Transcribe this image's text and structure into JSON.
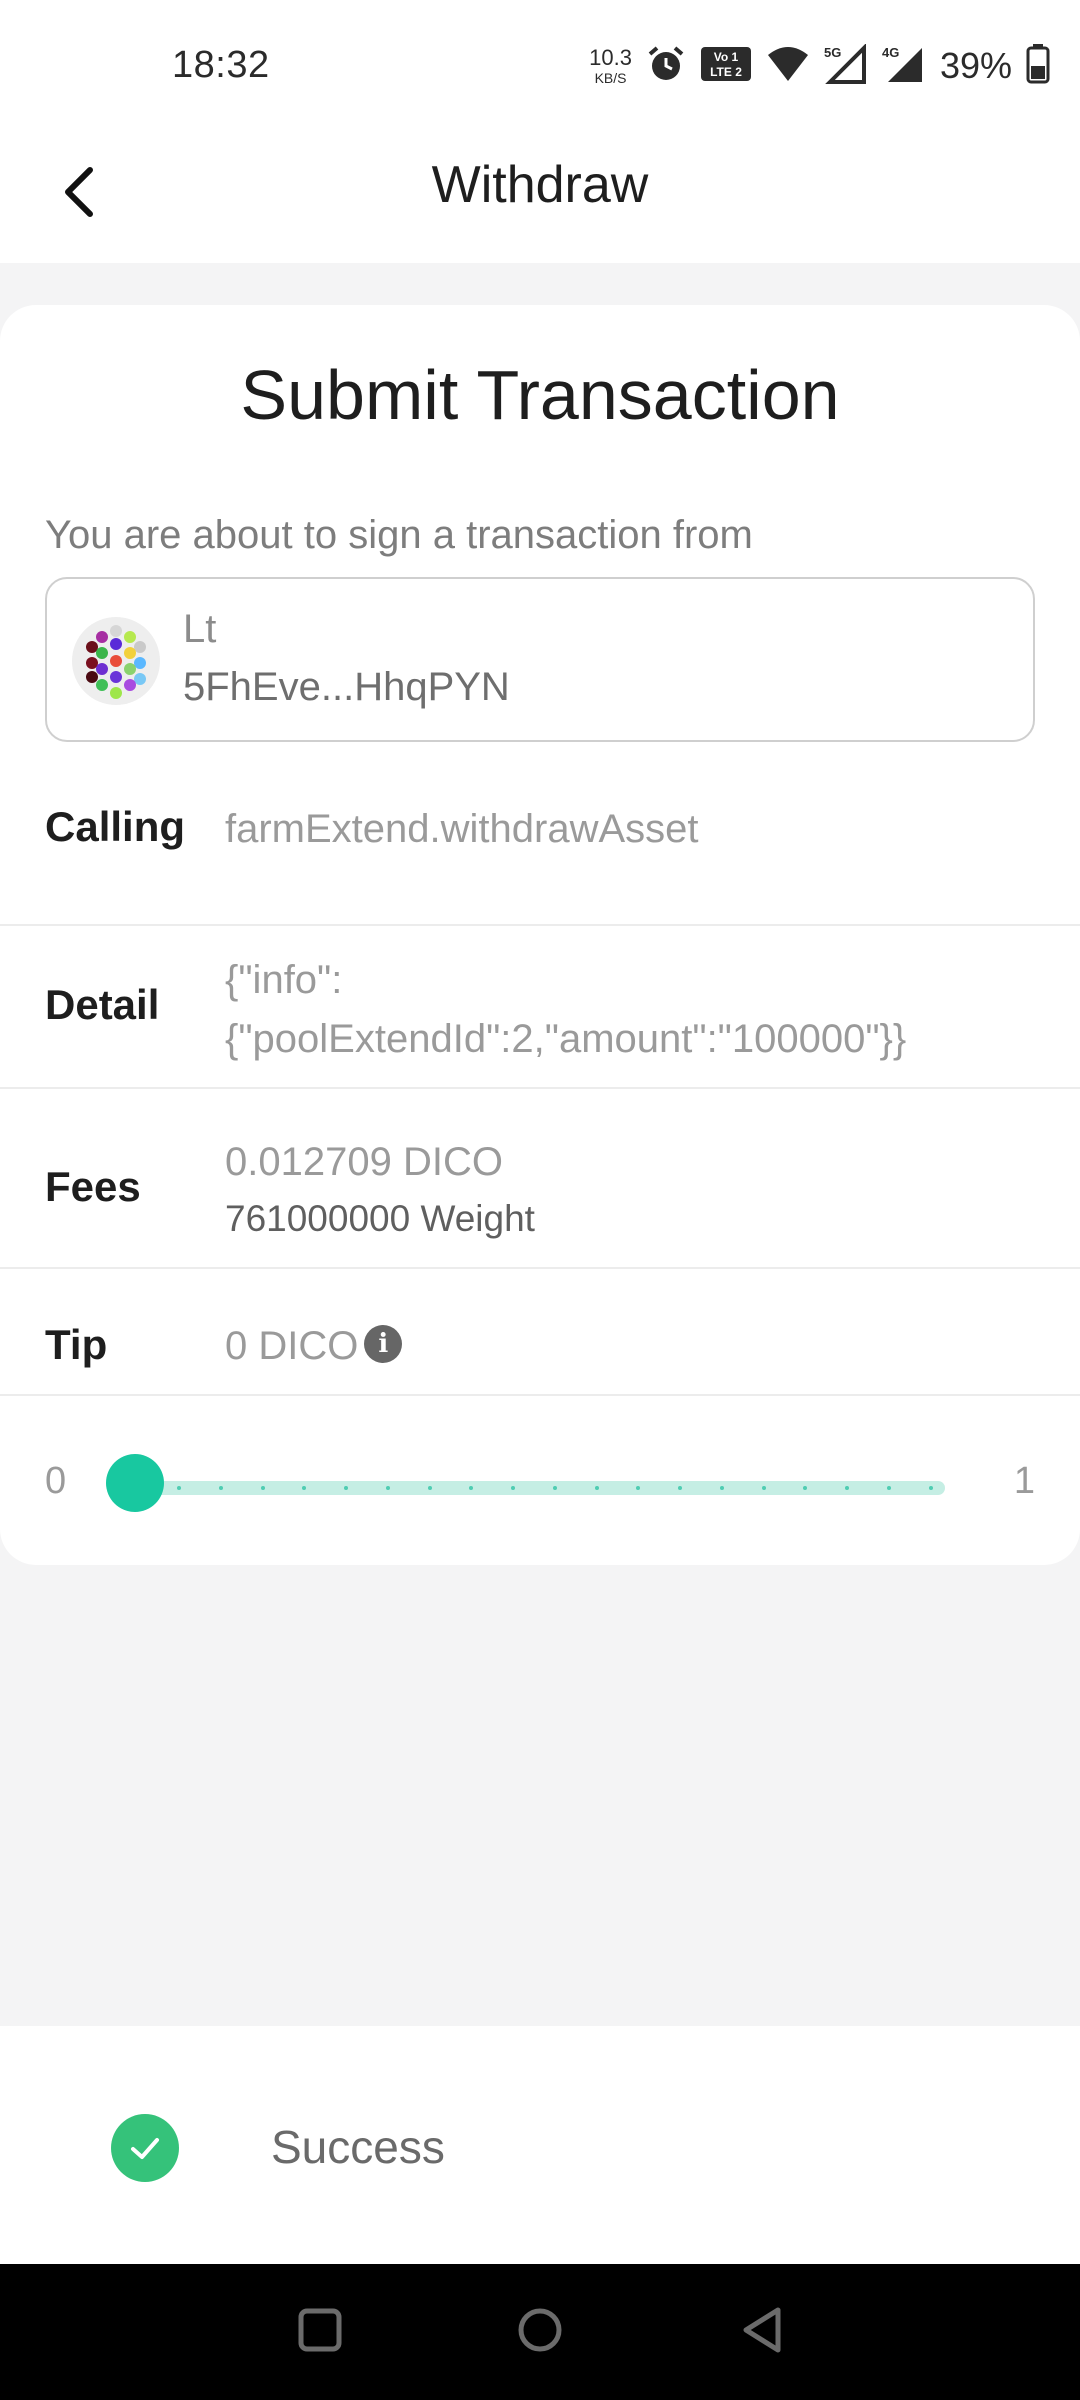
{
  "status_bar": {
    "time": "18:32",
    "net_speed_value": "10.3",
    "net_speed_unit": "KB/S",
    "volte_label": "Vo LTE 2",
    "sim1_label": "5G",
    "sim2_label": "4G",
    "battery_percent": "39%"
  },
  "header": {
    "title": "Withdraw",
    "back_icon": "chevron-left-icon"
  },
  "card": {
    "title": "Submit Transaction",
    "intro": "You are about to sign a transaction from",
    "account": {
      "name": "Lt",
      "address": "5FhEve...HhqPYN"
    },
    "rows": {
      "calling_label": "Calling",
      "calling_value": "farmExtend.withdrawAsset",
      "detail_label": "Detail",
      "detail_line1": "{\"info\":",
      "detail_line2": "{\"poolExtendId\":2,\"amount\":\"100000\"}}",
      "fees_label": "Fees",
      "fees_value": "0.012709 DICO",
      "fees_weight": "761000000 Weight",
      "tip_label": "Tip",
      "tip_value": "0 DICO"
    },
    "slider": {
      "min_label": "0",
      "max_label": "1",
      "value": 0,
      "accent_color": "#18c8a0"
    }
  },
  "toast": {
    "message": "Success",
    "color": "#35c27a"
  },
  "nav": {
    "recents_icon": "square-icon",
    "home_icon": "circle-icon",
    "back_icon": "triangle-back-icon"
  }
}
